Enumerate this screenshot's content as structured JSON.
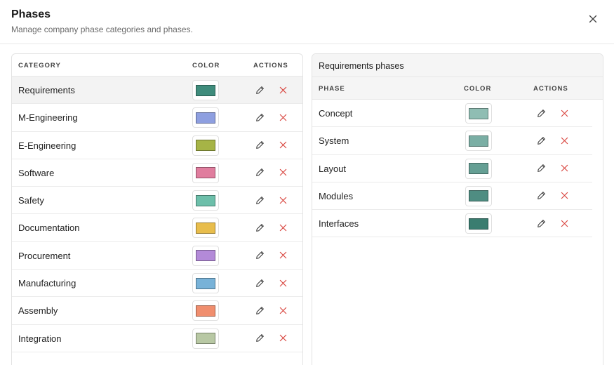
{
  "dialog": {
    "title": "Phases",
    "subtitle": "Manage company phase categories and phases."
  },
  "categories_table": {
    "headers": {
      "category": "CATEGORY",
      "color": "COLOR",
      "actions": "ACTIONS"
    },
    "rows": [
      {
        "name": "Requirements",
        "color": "#3f8c7c",
        "selected": true
      },
      {
        "name": "M-Engineering",
        "color": "#8e9fe0"
      },
      {
        "name": "E-Engineering",
        "color": "#a6b446"
      },
      {
        "name": "Software",
        "color": "#e07d9e"
      },
      {
        "name": "Safety",
        "color": "#6dbfaa"
      },
      {
        "name": "Documentation",
        "color": "#e8bd4c"
      },
      {
        "name": "Procurement",
        "color": "#b38ad8"
      },
      {
        "name": "Manufacturing",
        "color": "#78b2d8"
      },
      {
        "name": "Assembly",
        "color": "#f08e6e"
      },
      {
        "name": "Integration",
        "color": "#b8c8a4"
      }
    ]
  },
  "phases_table": {
    "title": "Requirements phases",
    "headers": {
      "phase": "PHASE",
      "color": "COLOR",
      "actions": "ACTIONS"
    },
    "rows": [
      {
        "name": "Concept",
        "color": "#8fbdb3"
      },
      {
        "name": "System",
        "color": "#7aaea4"
      },
      {
        "name": "Layout",
        "color": "#659f94"
      },
      {
        "name": "Modules",
        "color": "#4f8d82"
      },
      {
        "name": "Interfaces",
        "color": "#3a7d70"
      }
    ]
  },
  "icons": {
    "edit": "pencil-icon",
    "delete": "x-icon",
    "close": "close-icon"
  },
  "colors": {
    "delete": "#d9453f"
  }
}
